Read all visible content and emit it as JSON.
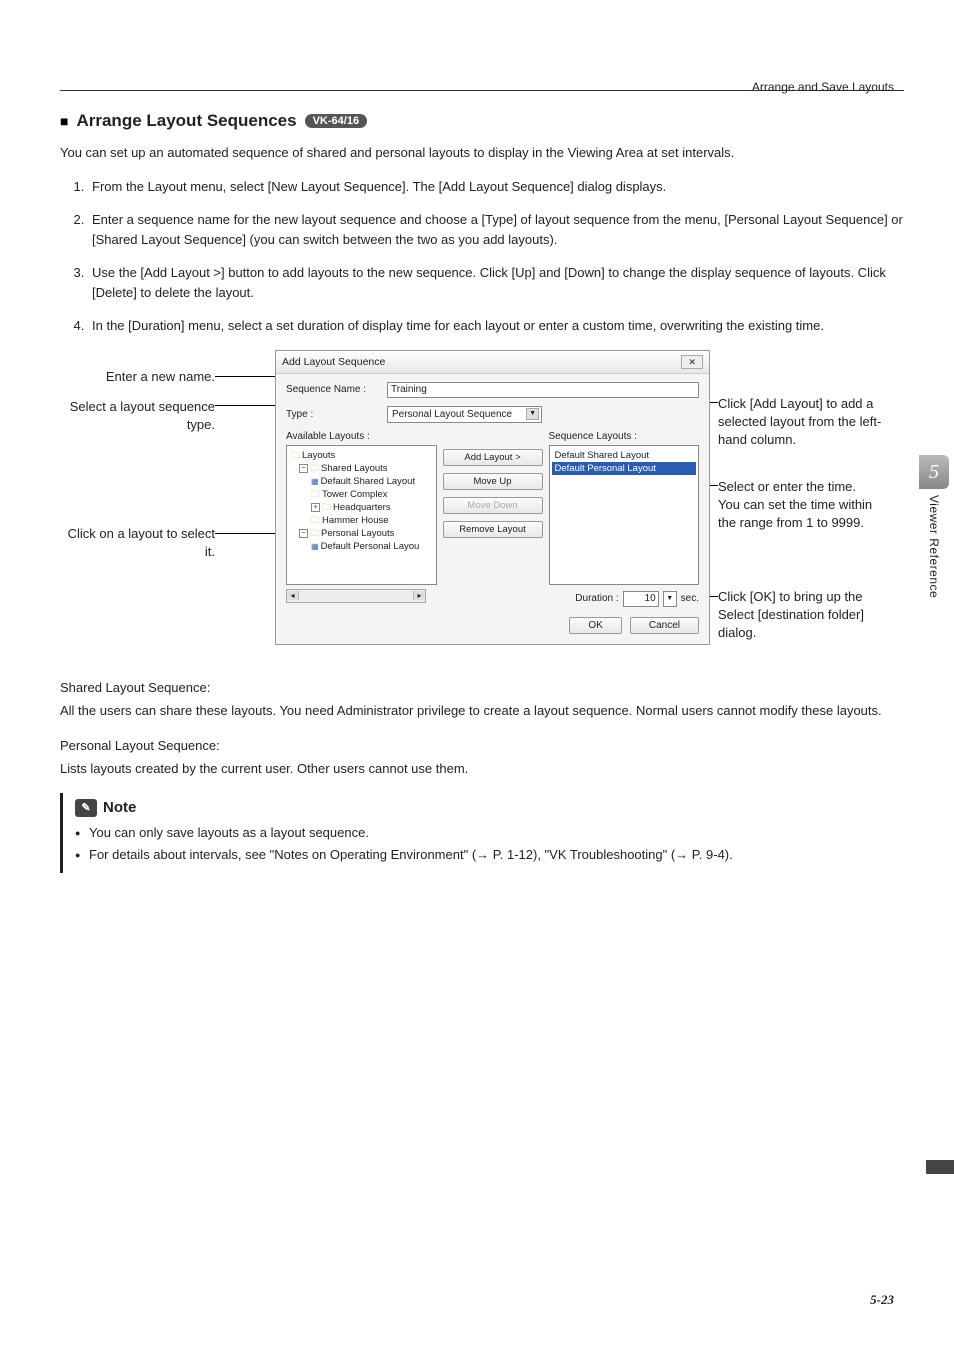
{
  "header": {
    "right": "Arrange and Save Layouts"
  },
  "section": {
    "bullet": "■",
    "title": "Arrange Layout Sequences",
    "badge": "VK-64/16",
    "intro": "You can set up an automated sequence of shared and personal layouts to display in the Viewing Area at set intervals."
  },
  "steps": [
    "From the Layout menu, select [New Layout Sequence]. The [Add Layout Sequence] dialog displays.",
    "Enter a sequence name for the new layout sequence and choose a [Type] of layout sequence from the menu, [Personal Layout Sequence] or [Shared Layout Sequence] (you can switch between the two as you add layouts).",
    "Use the [Add Layout >] button to add layouts to the new sequence. Click [Up] and [Down] to change the display sequence of layouts. Click [Delete] to delete the layout.",
    "In the [Duration] menu, select a set duration of display time for each layout or enter a custom time, overwriting the existing time."
  ],
  "annot": {
    "left": {
      "a1": "Enter a new name.",
      "a2": "Select a layout sequence type.",
      "a3": "Click on a layout to select it."
    },
    "right": {
      "r1": "Click [Add Layout] to add a selected layout from the left-hand column.",
      "r2": "Select or enter the time.\nYou can set the time within the range from 1 to 9999.",
      "r3": "Click [OK] to bring up the Select [destination folder] dialog."
    }
  },
  "dialog": {
    "title": "Add Layout Sequence",
    "close": "✕",
    "seqNameLabel": "Sequence Name :",
    "seqNameValue": "Training",
    "typeLabel": "Type :",
    "typeValue": "Personal Layout Sequence",
    "availableLabel": "Available Layouts :",
    "sequenceLabel": "Sequence Layouts :",
    "tree": {
      "root": "Layouts",
      "shared": "Shared Layouts",
      "defShared": "Default Shared Layout",
      "tower": "Tower Complex",
      "hq": "Headquarters",
      "hammer": "Hammer House",
      "personal": "Personal Layouts",
      "defPersonal": "Default Personal Layou"
    },
    "seqItems": {
      "i1": "Default Shared Layout",
      "i2": "Default Personal Layout"
    },
    "btns": {
      "add": "Add Layout  >",
      "up": "Move Up",
      "down": "Move Down",
      "remove": "Remove Layout"
    },
    "duration": {
      "label": "Duration :",
      "value": "10",
      "unit": "sec."
    },
    "ok": "OK",
    "cancel": "Cancel"
  },
  "sub": {
    "sharedH": "Shared Layout Sequence:",
    "sharedP": "All the users can share these layouts. You need Administrator privilege to create a layout sequence. Normal users cannot modify these layouts.",
    "personalH": "Personal Layout Sequence:",
    "personalP": "Lists layouts created by the current user. Other users cannot use them."
  },
  "note": {
    "title": "Note",
    "items": [
      "You can only save layouts as a layout sequence.",
      "For details about intervals, see \"Notes on Operating Environment\" (→ P. 1-12), \"VK Troubleshooting\" (→ P. 9-4)."
    ]
  },
  "side": {
    "num": "5",
    "label": "Viewer Reference"
  },
  "pageNum": "5-23"
}
